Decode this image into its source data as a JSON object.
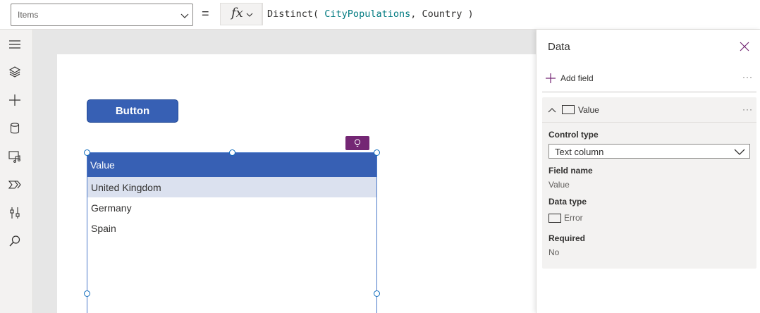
{
  "formula_bar": {
    "property": "Items",
    "equals": "=",
    "fx_label": "fx",
    "formula": {
      "function": "Distinct(",
      "source": "CityPopulations",
      "separator": ",",
      "field": "Country",
      "close": ")"
    }
  },
  "rail": {
    "icons": [
      "hamburger-menu-icon",
      "layers-icon",
      "insert-plus-icon",
      "data-cylinder-icon",
      "media-icon",
      "power-automate-icon",
      "tools-icon",
      "search-icon"
    ]
  },
  "canvas": {
    "button_label": "Button",
    "table": {
      "header": "Value",
      "rows": [
        "United Kingdom",
        "Germany",
        "Spain"
      ]
    },
    "accent_colors": {
      "button": "#3760b4",
      "ideas": "#742774",
      "selected_row": "#dbe1ef"
    }
  },
  "panel": {
    "title": "Data",
    "add_field": "Add field",
    "more": "···",
    "field": {
      "name_label": "Value",
      "control_type_label": "Control type",
      "control_type_value": "Text column",
      "field_name_label": "Field name",
      "field_name_value": "Value",
      "data_type_label": "Data type",
      "data_type_value": "Error",
      "required_label": "Required",
      "required_value": "No"
    }
  }
}
